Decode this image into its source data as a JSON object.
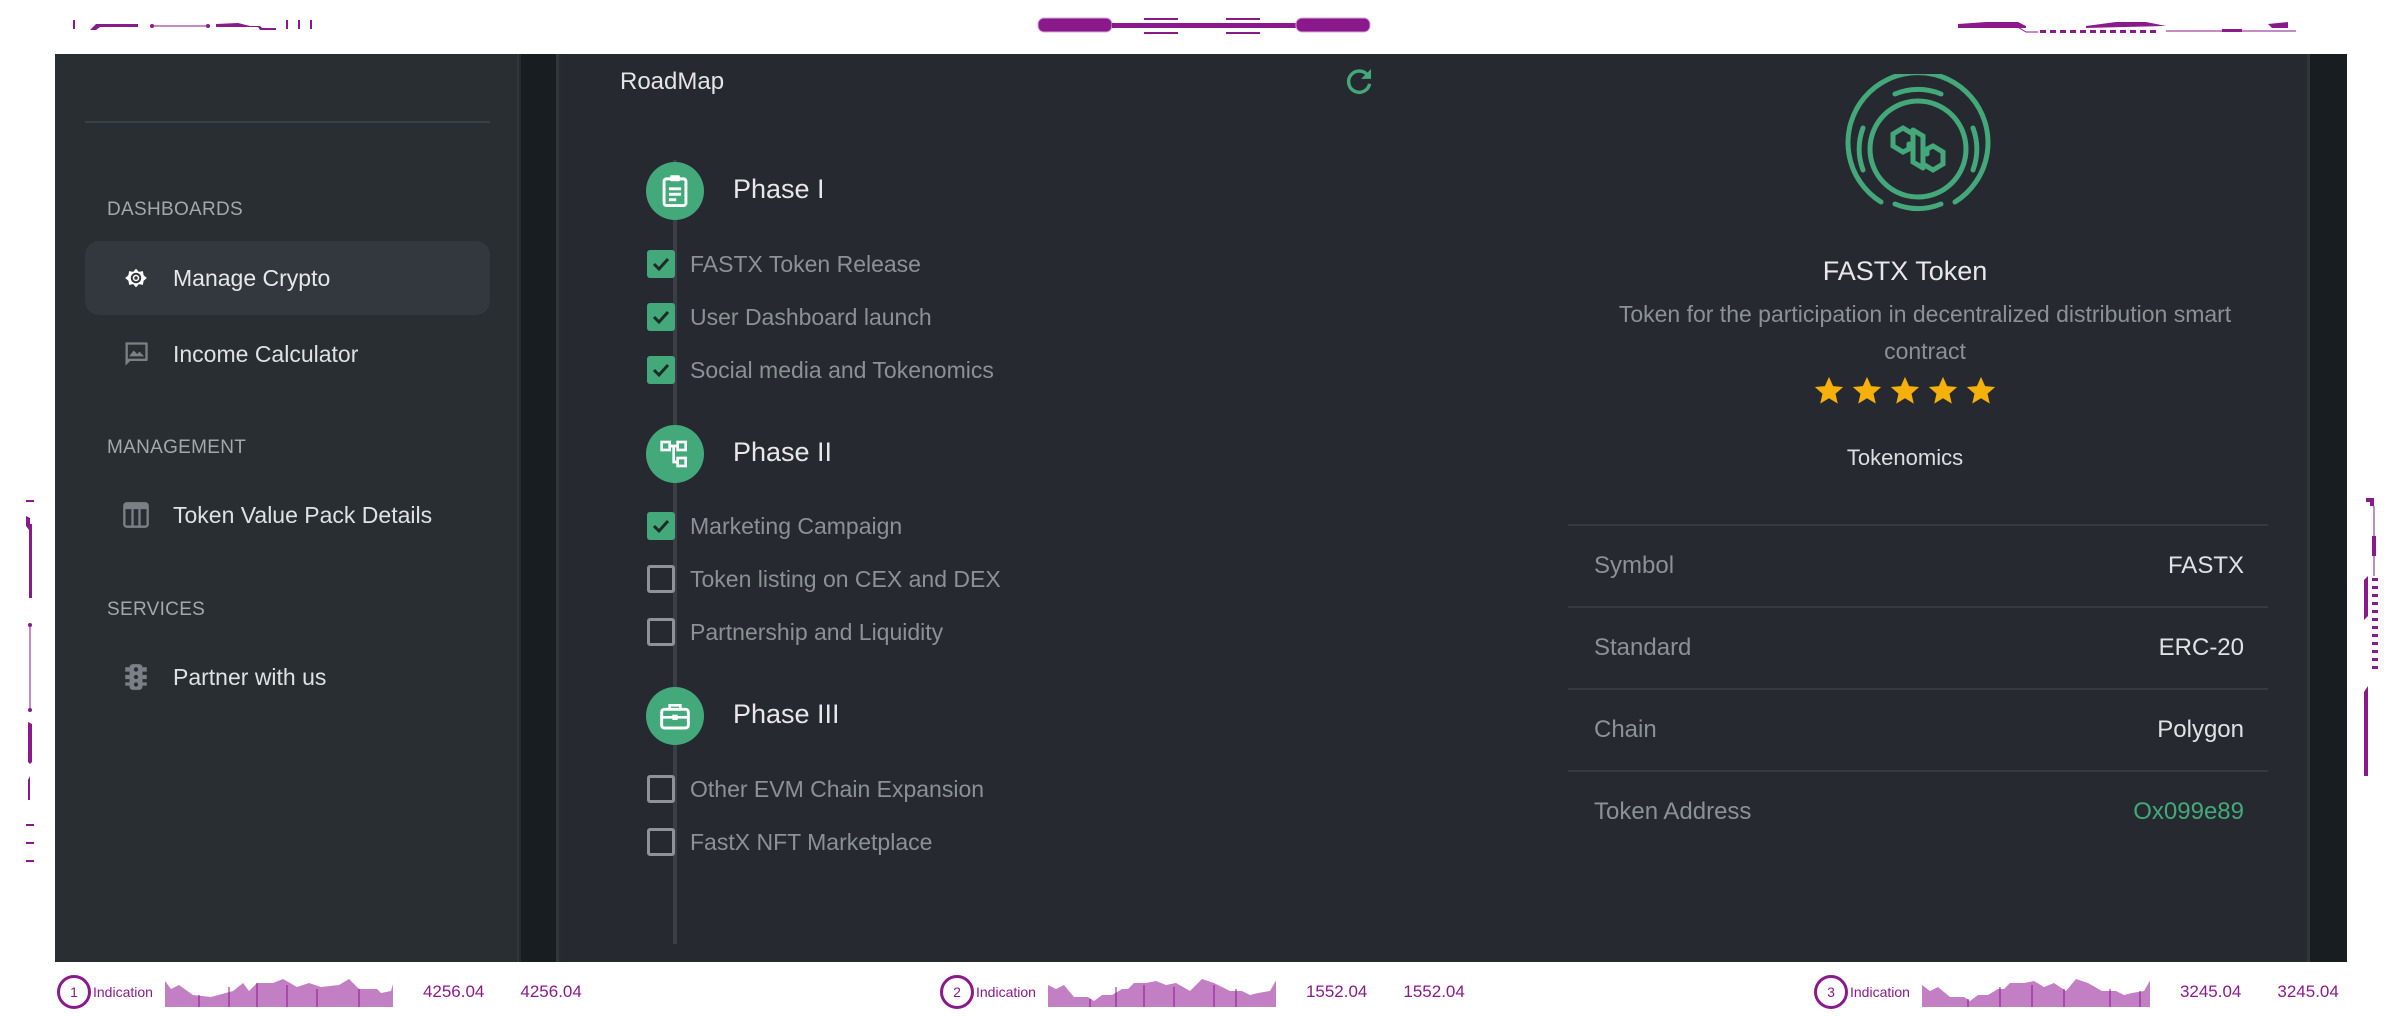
{
  "sidebar": {
    "sections": [
      {
        "label": "DASHBOARDS"
      },
      {
        "label": "MANAGEMENT"
      },
      {
        "label": "SERVICES"
      }
    ],
    "items": [
      {
        "label": "Manage Crypto",
        "icon": "gear-icon",
        "active": true
      },
      {
        "label": "Income Calculator",
        "icon": "image-message-icon",
        "active": false
      },
      {
        "label": "Token Value Pack Details",
        "icon": "table-icon",
        "active": false
      },
      {
        "label": "Partner with us",
        "icon": "traffic-light-icon",
        "active": false
      }
    ]
  },
  "roadmap": {
    "title": "RoadMap",
    "refresh_icon": "refresh-icon",
    "phases": [
      {
        "title": "Phase I",
        "icon": "clipboard-icon",
        "tasks": [
          {
            "label": "FASTX Token Release",
            "done": true
          },
          {
            "label": "User Dashboard launch",
            "done": true
          },
          {
            "label": "Social media and Tokenomics",
            "done": true
          }
        ]
      },
      {
        "title": "Phase II",
        "icon": "hierarchy-icon",
        "tasks": [
          {
            "label": "Marketing Campaign",
            "done": true
          },
          {
            "label": "Token listing on CEX and DEX",
            "done": false
          },
          {
            "label": "Partnership and Liquidity",
            "done": false
          }
        ]
      },
      {
        "title": "Phase III",
        "icon": "briefcase-icon",
        "tasks": [
          {
            "label": "Other EVM Chain Expansion",
            "done": false
          },
          {
            "label": "FastX NFT Marketplace",
            "done": false
          }
        ]
      }
    ]
  },
  "token": {
    "name": "FASTX Token",
    "description": "Token for the participation in decentralized distribution smart contract",
    "rating": 5,
    "rating_max": 5,
    "tokenomics_label": "Tokenomics",
    "details": [
      {
        "key": "Symbol",
        "value": "FASTX"
      },
      {
        "key": "Standard",
        "value": "ERC-20"
      },
      {
        "key": "Chain",
        "value": "Polygon"
      },
      {
        "key": "Token Address",
        "value": "Ox099e89",
        "link": true
      }
    ]
  },
  "ticker": [
    {
      "index": "1",
      "label": "Indication",
      "value_a": "4256.04",
      "value_b": "4256.04"
    },
    {
      "index": "2",
      "label": "Indication",
      "value_a": "1552.04",
      "value_b": "1552.04"
    },
    {
      "index": "3",
      "label": "Indication",
      "value_a": "3245.04",
      "value_b": "3245.04"
    }
  ],
  "colors": {
    "accent": "#44a97a",
    "star": "#f5b00b",
    "frame": "#8a1a8c"
  }
}
